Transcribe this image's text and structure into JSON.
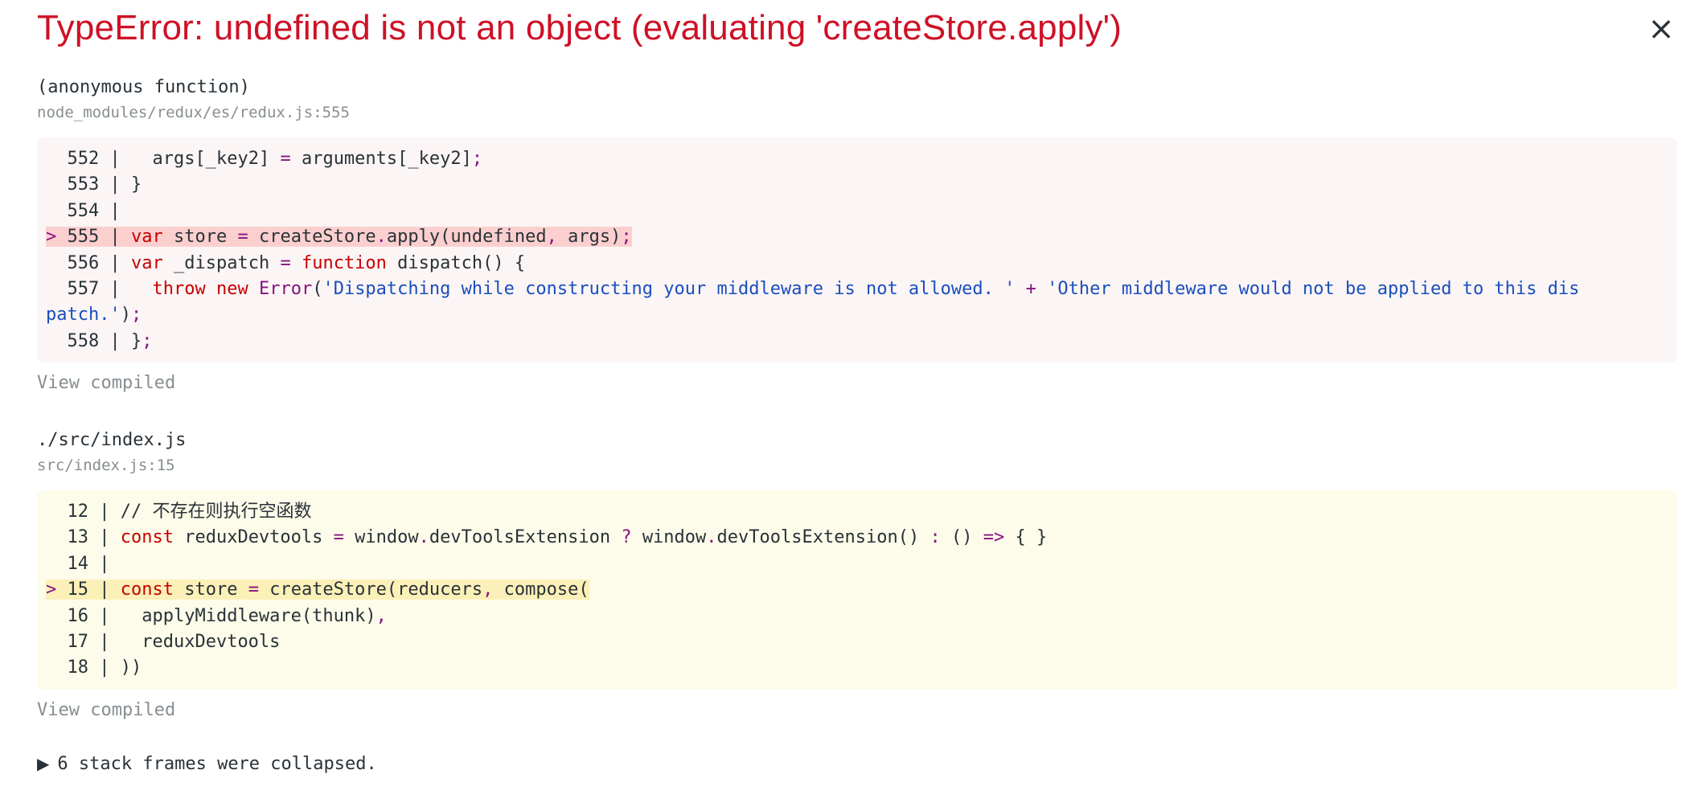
{
  "error": {
    "title": "TypeError: undefined is not an object (evaluating 'createStore.apply')",
    "close_label": "×"
  },
  "frames": [
    {
      "function_name": "(anonymous function)",
      "location": "node_modules/redux/es/redux.js:555",
      "view_compiled_label": "View compiled",
      "highlight_color": "#fccfcf",
      "box_color": "#fbf5f5",
      "lines": [
        {
          "marker": " ",
          "number": "552",
          "code": "  args[_key2] = arguments[_key2];",
          "highlighted": false
        },
        {
          "marker": " ",
          "number": "553",
          "code": "}",
          "highlighted": false
        },
        {
          "marker": " ",
          "number": "554",
          "code": "",
          "highlighted": false
        },
        {
          "marker": ">",
          "number": "555",
          "code": "var store = createStore.apply(undefined, args);",
          "highlighted": true
        },
        {
          "marker": " ",
          "number": "556",
          "code": "var _dispatch = function dispatch() {",
          "highlighted": false
        },
        {
          "marker": " ",
          "number": "557",
          "code": "  throw new Error('Dispatching while constructing your middleware is not allowed. ' + 'Other middleware would not be applied to this dispatch.');",
          "highlighted": false
        },
        {
          "marker": " ",
          "number": "558",
          "code": "};",
          "highlighted": false
        }
      ]
    },
    {
      "function_name": "./src/index.js",
      "location": "src/index.js:15",
      "view_compiled_label": "View compiled",
      "highlight_color": "#fbf0b8",
      "box_color": "#fdfbe9",
      "lines": [
        {
          "marker": " ",
          "number": "12",
          "code": "// 不存在则执行空函数",
          "highlighted": false
        },
        {
          "marker": " ",
          "number": "13",
          "code": "const reduxDevtools = window.devToolsExtension ? window.devToolsExtension() : () => { }",
          "highlighted": false
        },
        {
          "marker": " ",
          "number": "14",
          "code": "",
          "highlighted": false
        },
        {
          "marker": ">",
          "number": "15",
          "code": "const store = createStore(reducers, compose(",
          "highlighted": true
        },
        {
          "marker": " ",
          "number": "16",
          "code": "  applyMiddleware(thunk),",
          "highlighted": false
        },
        {
          "marker": " ",
          "number": "17",
          "code": "  reduxDevtools",
          "highlighted": false
        },
        {
          "marker": " ",
          "number": "18",
          "code": "))",
          "highlighted": false
        }
      ]
    }
  ],
  "collapsed": {
    "arrow": "▶",
    "label": "6 stack frames were collapsed."
  }
}
